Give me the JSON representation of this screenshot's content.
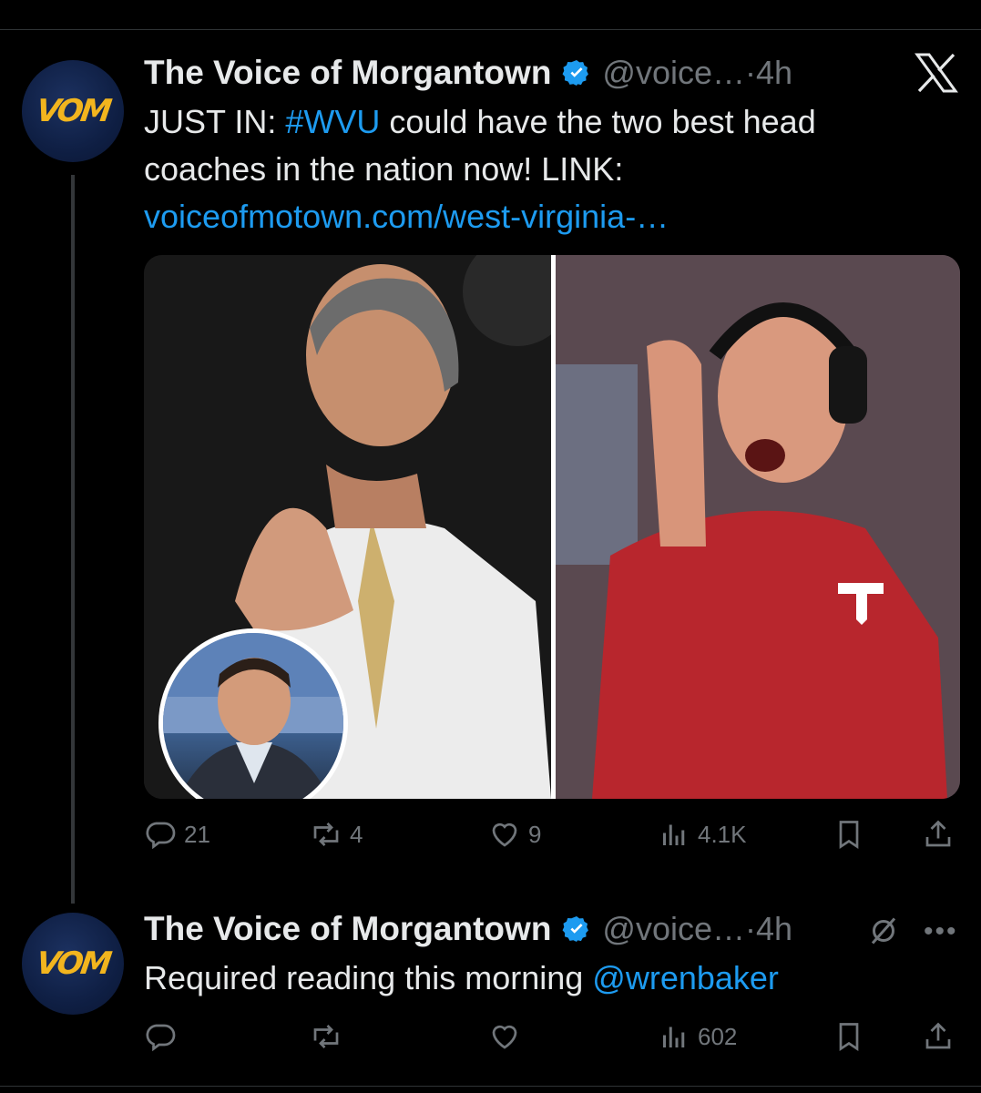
{
  "tweets": [
    {
      "avatar_text": "VOM",
      "display_name": "The Voice of Morgantown",
      "handle": "@voice…",
      "separator": " · ",
      "time": "4h",
      "text_before": "JUST IN: ",
      "hashtag": "#WVU",
      "text_after": " could have the two best head coaches in the nation now! LINK:",
      "link": "voiceofmotown.com/west-virginia-…",
      "stats": {
        "replies": "21",
        "retweets": "4",
        "likes": "9",
        "views": "4.1K"
      }
    },
    {
      "avatar_text": "VOM",
      "display_name": "The Voice of Morgantown",
      "handle": "@voice…",
      "separator": " · ",
      "time": "4h",
      "text_before": "Required reading this morning ",
      "mention": "@wrenbaker",
      "stats": {
        "replies": "",
        "retweets": "",
        "likes": "",
        "views": "602"
      }
    }
  ],
  "icons": {
    "verified": "verified-badge-icon",
    "x_logo": "x-logo-icon",
    "reply": "reply-icon",
    "retweet": "retweet-icon",
    "like": "heart-icon",
    "views": "views-icon",
    "bookmark": "bookmark-icon",
    "share": "share-icon",
    "grok": "grok-icon",
    "more": "more-dots-icon"
  },
  "colors": {
    "background": "#000000",
    "text": "#e7e9ea",
    "muted": "#71767b",
    "link": "#1d9bf0",
    "brand_gold": "#f2b51e",
    "brand_navy": "#0f1f44"
  }
}
